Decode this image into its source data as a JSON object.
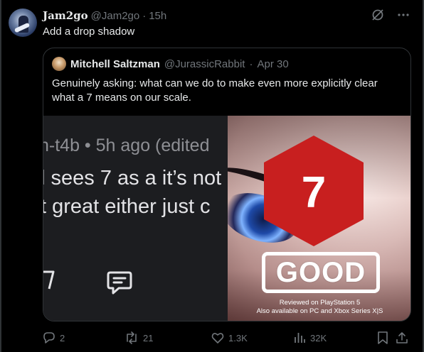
{
  "author": {
    "name": "Jam2go",
    "handle": "@Jam2go",
    "separator": "·",
    "time": "15h",
    "avatar_icon": "user-avatar"
  },
  "tweet": {
    "text": "Add a drop shadow"
  },
  "header_icons": [
    "grok-icon",
    "more-icon"
  ],
  "quoted": {
    "name": "Mitchell Saltzman",
    "handle": "@JurassicRabbit",
    "separator": "·",
    "date": "Apr 30",
    "text": "Genuinely asking: what can we do to make even more explicitly clear what a 7 means on our scale."
  },
  "screenshot": {
    "line1": "n-t4b • 5h ago (edited",
    "line2": "l sees 7 as a it’s not",
    "line3": "t great either just c"
  },
  "review_art": {
    "score": "7",
    "verdict": "GOOD",
    "reviewed_on": "Reviewed on PlayStation 5",
    "also_on": "Also available on PC and Xbox Series X|S",
    "score_color": "#c81f1f"
  },
  "actions": {
    "replies": "2",
    "reposts": "21",
    "likes": "1.3K",
    "views": "32K"
  }
}
